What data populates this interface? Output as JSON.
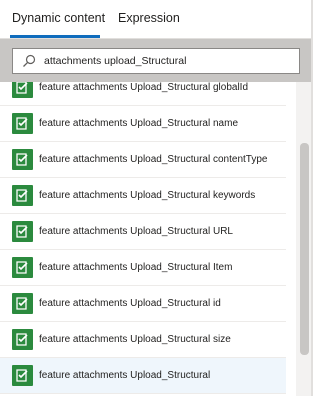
{
  "tabs": [
    {
      "label": "Dynamic content",
      "active": true
    },
    {
      "label": "Expression",
      "active": false
    }
  ],
  "search": {
    "value": "attachments upload_Structural",
    "icon": "search-icon"
  },
  "colors": {
    "accent": "#0f6cbd",
    "token_green": "#2b8a3e",
    "search_band": "#c8c6c4",
    "selected_row": "#eff6fc"
  },
  "items": [
    {
      "label": "feature attachments Upload_Structural globalId",
      "icon": "checklist-icon"
    },
    {
      "label": "feature attachments Upload_Structural name",
      "icon": "checklist-icon"
    },
    {
      "label": "feature attachments Upload_Structural contentType",
      "icon": "checklist-icon"
    },
    {
      "label": "feature attachments Upload_Structural keywords",
      "icon": "checklist-icon"
    },
    {
      "label": "feature attachments Upload_Structural URL",
      "icon": "checklist-icon"
    },
    {
      "label": "feature attachments Upload_Structural Item",
      "icon": "checklist-icon"
    },
    {
      "label": "feature attachments Upload_Structural id",
      "icon": "checklist-icon"
    },
    {
      "label": "feature attachments Upload_Structural size",
      "icon": "checklist-icon"
    },
    {
      "label": "feature attachments Upload_Structural",
      "icon": "checklist-icon",
      "selected": true
    }
  ]
}
